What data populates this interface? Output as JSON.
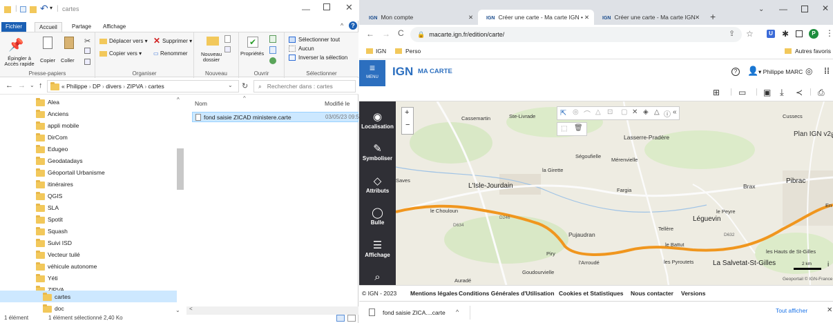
{
  "explorer": {
    "title": "cartes",
    "tabs": [
      "Fichier",
      "Accueil",
      "Partage",
      "Affichage"
    ],
    "ribbon": {
      "presse_papiers": {
        "label": "Presse-papiers",
        "pin": "Épingler à Accès rapide",
        "copy": "Copier",
        "paste": "Coller"
      },
      "organiser": {
        "label": "Organiser",
        "move": "Déplacer vers",
        "delete": "Supprimer",
        "copy_to": "Copier vers",
        "rename": "Renommer"
      },
      "nouveau": {
        "label": "Nouveau",
        "new_folder": "Nouveau dossier"
      },
      "ouvrir": {
        "label": "Ouvrir",
        "properties": "Propriétés"
      },
      "selectionner": {
        "label": "Sélectionner",
        "select_all": "Sélectionner tout",
        "none": "Aucun",
        "invert": "Inverser la sélection"
      }
    },
    "address": {
      "crumbs": [
        "«",
        "Philippe",
        "DP",
        "divers",
        "ZIPVA",
        "cartes"
      ],
      "search_placeholder": "Rechercher dans : cartes"
    },
    "tree": [
      "Alea",
      "Anciens",
      "appli mobile",
      "DirCom",
      "Edugeo",
      "Geodatadays",
      "Géoportail Urbanisme",
      "itinéraires",
      "QGIS",
      "SLA",
      "Spotit",
      "Squash",
      "Suivi ISD",
      "Vecteur tuilé",
      "véhicule autonome",
      "Yéti",
      "ZIPVA",
      "cartes",
      "doc"
    ],
    "columns": {
      "name": "Nom",
      "modified": "Modifié le"
    },
    "files": [
      {
        "name": "fond saisie ZICAD ministere.carte",
        "modified": "03/05/23 09:51"
      }
    ],
    "status": {
      "count": "1 élément",
      "selected": "1 élément sélectionné  2,40 Ko"
    }
  },
  "browser": {
    "tabs": [
      {
        "label": "Mon compte",
        "favicon": "IGN"
      },
      {
        "label": "Créer une carte - Ma carte IGN •",
        "favicon": "IGN"
      },
      {
        "label": "Créer une carte - Ma carte IGN",
        "favicon": "IGN"
      }
    ],
    "url": "macarte.ign.fr/edition/carte/",
    "bookmarks": [
      "IGN",
      "Perso"
    ],
    "other_bookmarks": "Autres favoris",
    "profile_initial": "P"
  },
  "ign": {
    "menu_label": "MENU",
    "logo": "IGN",
    "app_name": "MA CARTE",
    "user": "Philippe MARC",
    "sidebar": [
      "Localisation",
      "Symboliser",
      "Attributs",
      "Bulle",
      "Affichage"
    ],
    "layer_name": "Plan IGN v2",
    "scale_label": "2 km",
    "attribution": "Geoportail © IGN-France",
    "places": [
      "Cassemartin",
      "Ste-Livrade",
      "Cussecs",
      "Lasserre-Pradère",
      "Ségoufielle",
      "Mérenvielle",
      "la Girette",
      "Saves",
      "L'Isle-Jourdain",
      "Fargia",
      "Brax",
      "Pibrac",
      "le Chouloun",
      "le Peyre",
      "Léguevin",
      "Tellère",
      "Pujaudran",
      "le Battut",
      "Piry",
      "les Hauts de St-Gilles",
      "l'Arroudé",
      "les Pyroutets",
      "La Salvetat-St-Gilles",
      "Goudourvielle",
      "Auradé",
      "En"
    ],
    "roads": [
      "D634",
      "D246",
      "D632"
    ],
    "footer": [
      "© IGN - 2023",
      "Mentions légales",
      "Conditions Générales d'Utilisation",
      "Cookies et Statistiques",
      "Nous contacter",
      "Versions"
    ],
    "route_color": "#f0961e"
  },
  "download": {
    "file": "fond saisie ZICA....carte",
    "show_all": "Tout afficher"
  }
}
